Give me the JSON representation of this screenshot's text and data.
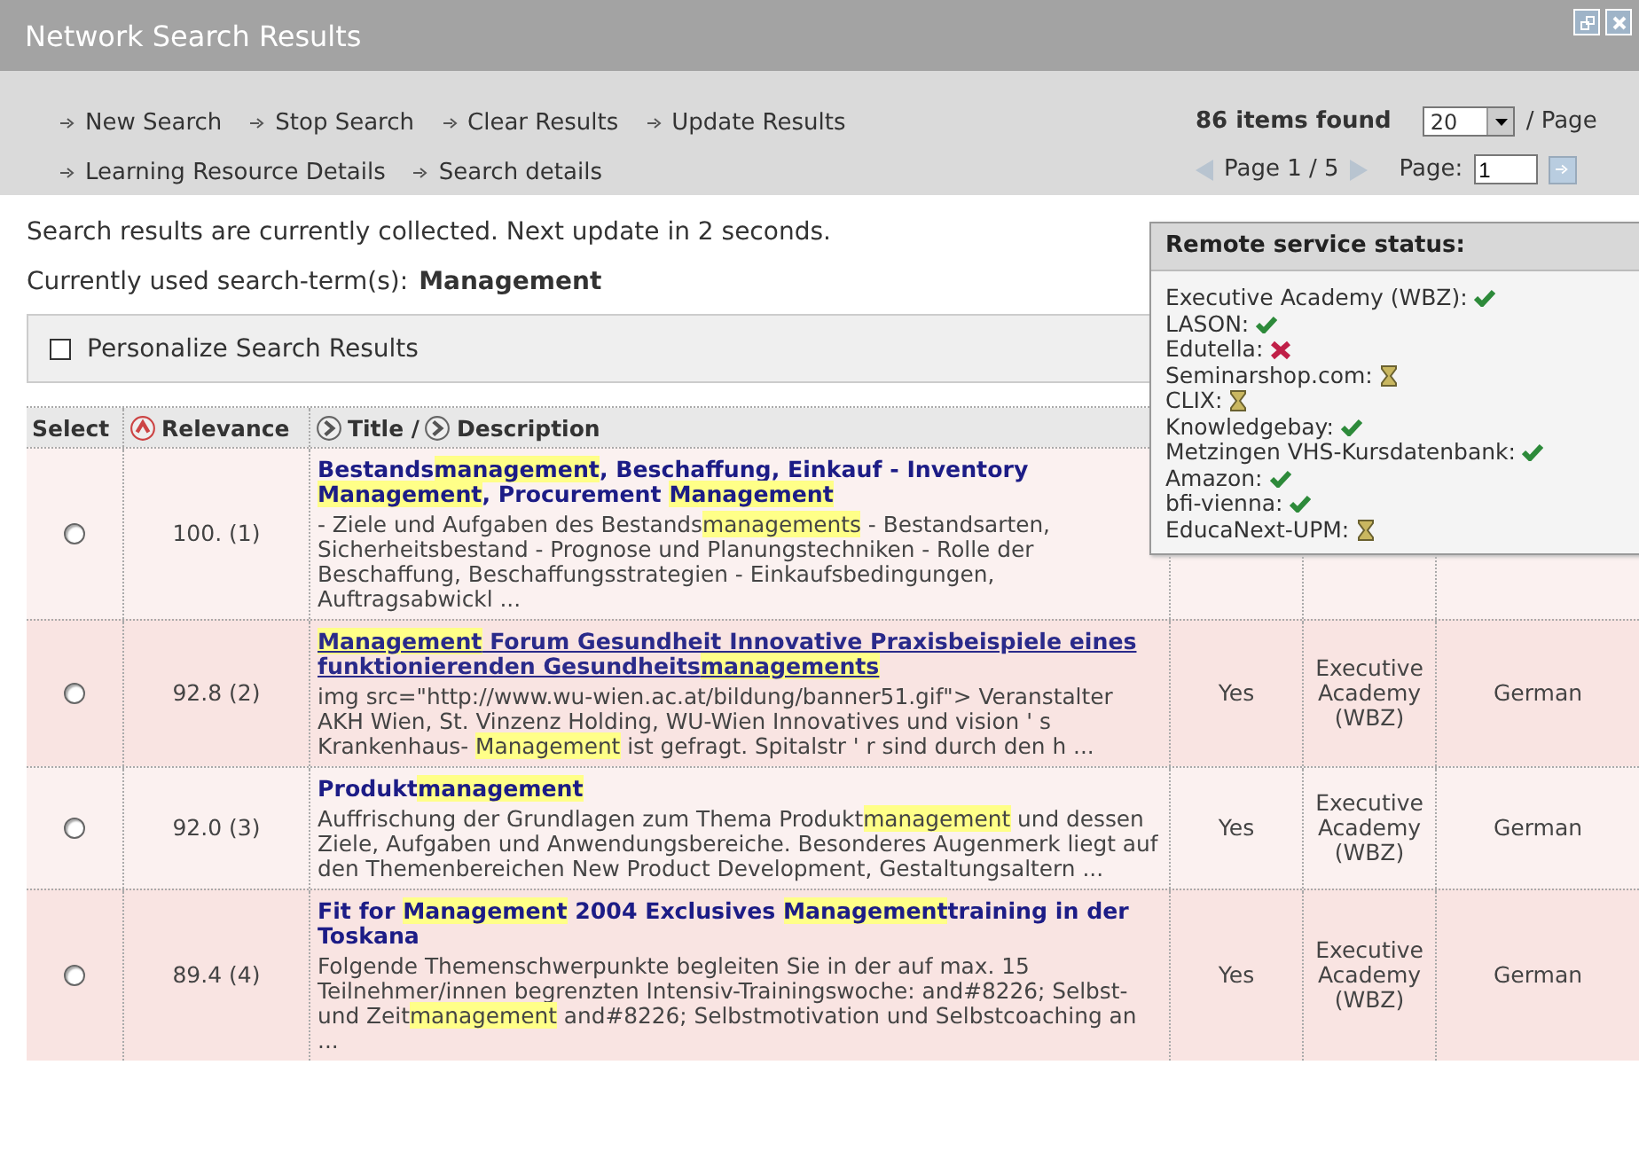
{
  "window": {
    "title": "Network Search Results"
  },
  "toolbar": {
    "links": [
      "New Search",
      "Stop Search",
      "Clear Results",
      "Update Results",
      "Learning Resource Details",
      "Search details"
    ],
    "items_found": "86 items found",
    "page_size": "20",
    "per_page_label": "/ Page",
    "page_info": "Page 1 / 5",
    "page_label": "Page:",
    "page_value": "1"
  },
  "status_message": "Search results are currently collected. Next update in 2 seconds.",
  "search_term": {
    "label": "Currently used search-term(s):",
    "value": "Management"
  },
  "personalize": {
    "label": "Personalize Search Results",
    "checked": false
  },
  "table": {
    "columns": [
      "Select",
      "Relevance",
      "Title /",
      "Description"
    ],
    "rows": [
      {
        "selected": false,
        "relevance": "100. (1)",
        "link": false,
        "title": [
          {
            "text": "Bestands",
            "hl": false
          },
          {
            "text": "management",
            "hl": true
          },
          {
            "text": ", Beschaffung, Einkauf - Inventory ",
            "hl": false
          },
          {
            "text": "Management",
            "hl": true
          },
          {
            "text": ", Procurement ",
            "hl": false
          },
          {
            "text": "Management",
            "hl": true
          }
        ],
        "description": [
          {
            "text": "- Ziele und Aufgaben des Bestands",
            "hl": false
          },
          {
            "text": "managements",
            "hl": true
          },
          {
            "text": " - Bestandsarten, Sicherheitsbestand - Prognose und Planungstechniken - Rolle der Beschaffung, Beschaffungsstrategien - Einkaufsbedingungen, Auftragsabwickl ...",
            "hl": false
          }
        ]
      },
      {
        "selected": false,
        "relevance": "92.8 (2)",
        "link": true,
        "title": [
          {
            "text": "Management",
            "hl": true
          },
          {
            "text": " Forum Gesundheit Innovative Praxisbeispiele eines funktionierenden Gesundheits",
            "hl": false
          },
          {
            "text": "managements",
            "hl": true
          }
        ],
        "description": [
          {
            "text": "img src=\"http://www.wu-wien.ac.at/bildung/banner51.gif\"> Veranstalter AKH Wien, St. Vinzenz Holding, WU-Wien Innovatives und vision ' s Krankenhaus- ",
            "hl": false
          },
          {
            "text": "Management",
            "hl": true
          },
          {
            "text": " ist gefragt. Spitalstr ' r sind durch den h ...",
            "hl": false
          }
        ],
        "available": "Yes",
        "provider": "Executive Academy (WBZ)",
        "language": "German"
      },
      {
        "selected": false,
        "relevance": "92.0 (3)",
        "link": false,
        "title": [
          {
            "text": "Produkt",
            "hl": false
          },
          {
            "text": "management",
            "hl": true
          }
        ],
        "description": [
          {
            "text": "Auffrischung der Grundlagen zum Thema Produkt",
            "hl": false
          },
          {
            "text": "management",
            "hl": true
          },
          {
            "text": " und dessen Ziele, Aufgaben und Anwendungsbereiche. Besonderes Augenmerk liegt auf den Themenbereichen New Product Development, Gestaltungsaltern ...",
            "hl": false
          }
        ],
        "available": "Yes",
        "provider": "Executive Academy (WBZ)",
        "language": "German"
      },
      {
        "selected": false,
        "relevance": "89.4 (4)",
        "link": false,
        "title": [
          {
            "text": "Fit for ",
            "hl": false
          },
          {
            "text": "Management",
            "hl": true
          },
          {
            "text": " 2004 Exclusives ",
            "hl": false
          },
          {
            "text": "Management",
            "hl": true
          },
          {
            "text": "training in der Toskana",
            "hl": false
          }
        ],
        "description": [
          {
            "text": "Folgende Themenschwerpunkte begleiten Sie in der auf max. 15 Teilnehmer/innen begrenzten Intensiv-Trainingswoche: and#8226; Selbst- und Zeit",
            "hl": false
          },
          {
            "text": "management",
            "hl": true
          },
          {
            "text": " and#8226; Selbstmotivation und Selbstcoaching an ...",
            "hl": false
          }
        ],
        "available": "Yes",
        "provider": "Executive Academy (WBZ)",
        "language": "German"
      }
    ]
  },
  "remote_status": {
    "title": "Remote service status:",
    "services": [
      {
        "name": "Executive Academy (WBZ):",
        "kind": "ok"
      },
      {
        "name": "LASON:",
        "kind": "ok"
      },
      {
        "name": "Edutella:",
        "kind": "error"
      },
      {
        "name": "Seminarshop.com:",
        "kind": "pending"
      },
      {
        "name": "CLIX:",
        "kind": "pending"
      },
      {
        "name": "Knowledgebay:",
        "kind": "ok"
      },
      {
        "name": "Metzingen VHS-Kursdatenbank:",
        "kind": "ok"
      },
      {
        "name": "Amazon:",
        "kind": "ok"
      },
      {
        "name": "bfi-vienna:",
        "kind": "ok"
      },
      {
        "name": "EducaNext-UPM:",
        "kind": "pending"
      }
    ]
  }
}
